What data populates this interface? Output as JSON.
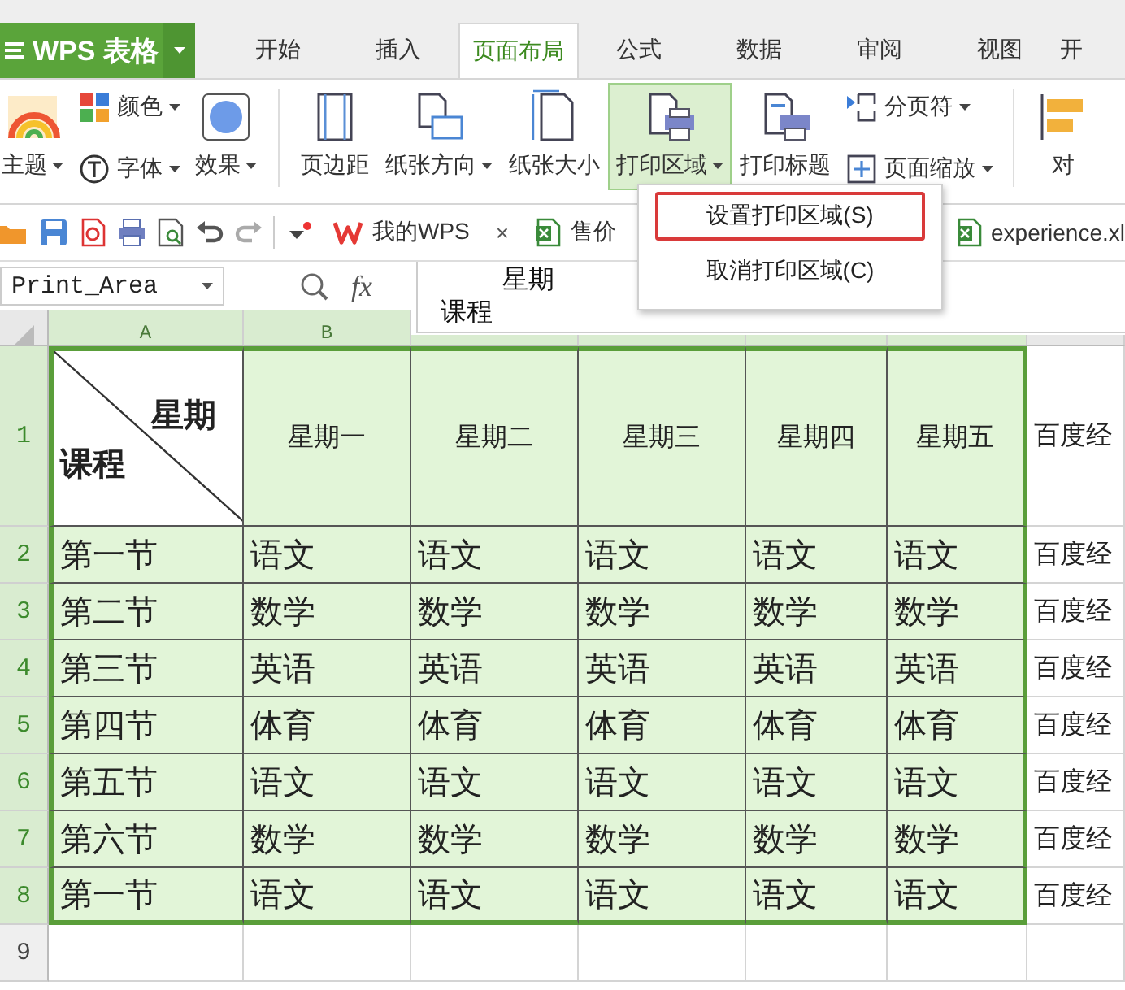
{
  "app_button": {
    "label": "WPS 表格"
  },
  "tabs": [
    {
      "label": "开始",
      "selected": false
    },
    {
      "label": "插入",
      "selected": false
    },
    {
      "label": "页面布局",
      "selected": true
    },
    {
      "label": "公式",
      "selected": false
    },
    {
      "label": "数据",
      "selected": false
    },
    {
      "label": "审阅",
      "selected": false
    },
    {
      "label": "视图",
      "selected": false
    },
    {
      "label": "开",
      "selected": false
    }
  ],
  "ribbon": [
    {
      "kind": "large",
      "label": "主题",
      "dropdown": true,
      "open": false
    },
    {
      "kind": "small",
      "label": "颜色",
      "dropdown": true,
      "open": false
    },
    {
      "kind": "small",
      "label": "字体",
      "dropdown": true,
      "open": false
    },
    {
      "kind": "large",
      "label": "效果",
      "dropdown": true,
      "open": false
    },
    {
      "kind": "separator"
    },
    {
      "kind": "large",
      "label": "页边距",
      "dropdown": false,
      "open": false
    },
    {
      "kind": "large",
      "label": "纸张方向",
      "dropdown": true,
      "open": false
    },
    {
      "kind": "large",
      "label": "纸张大小",
      "dropdown": false,
      "open": false
    },
    {
      "kind": "large",
      "label": "打印区域",
      "dropdown": true,
      "open": true
    },
    {
      "kind": "large",
      "label": "打印标题",
      "dropdown": false,
      "open": false
    },
    {
      "kind": "small",
      "label": "分页符",
      "dropdown": true,
      "open": false
    },
    {
      "kind": "small",
      "label": "页面缩放",
      "dropdown": true,
      "open": false
    },
    {
      "kind": "separator"
    },
    {
      "kind": "large",
      "label": "对",
      "dropdown": false,
      "open": false
    }
  ],
  "doc_tabs": [
    {
      "label": "我的WPS",
      "close_glyph": "×"
    },
    {
      "label": "售价"
    },
    {
      "label": "experience.xl"
    }
  ],
  "name_box": {
    "value": "Print_Area"
  },
  "formula": {
    "function_button": "fx",
    "lines": [
      "星期",
      "课程"
    ]
  },
  "menu": {
    "items": [
      {
        "label": "设置打印区域(S)",
        "selected": true
      },
      {
        "label": "取消打印区域(C)",
        "selected": false
      }
    ]
  },
  "sheet": {
    "columns": [
      {
        "label": "A",
        "in_print_area": true
      },
      {
        "label": "B",
        "in_print_area": true
      },
      {
        "in_print_area": true
      },
      {
        "in_print_area": true
      },
      {
        "in_print_area": true
      },
      {
        "in_print_area": true
      },
      {
        "in_print_area": false
      }
    ],
    "rows": [
      {
        "number": "1",
        "in_print_area": true,
        "cells": [
          {
            "kind": "diagonal",
            "top": "星期",
            "bottom": "课程"
          },
          {
            "kind": "centered",
            "text": "星期一"
          },
          {
            "kind": "centered",
            "text": "星期二"
          },
          {
            "kind": "centered",
            "text": "星期三"
          },
          {
            "kind": "centered",
            "text": "星期四"
          },
          {
            "kind": "centered",
            "text": "星期五"
          },
          {
            "kind": "plain",
            "text": "百度经"
          }
        ]
      },
      {
        "number": "2",
        "in_print_area": true,
        "cells": [
          "第一节",
          "语文",
          "语文",
          "语文",
          "语文",
          "语文",
          "百度经"
        ]
      },
      {
        "number": "3",
        "in_print_area": true,
        "cells": [
          "第二节",
          "数学",
          "数学",
          "数学",
          "数学",
          "数学",
          "百度经"
        ]
      },
      {
        "number": "4",
        "in_print_area": true,
        "cells": [
          "第三节",
          "英语",
          "英语",
          "英语",
          "英语",
          "英语",
          "百度经"
        ]
      },
      {
        "number": "5",
        "in_print_area": true,
        "cells": [
          "第四节",
          "体育",
          "体育",
          "体育",
          "体育",
          "体育",
          "百度经"
        ]
      },
      {
        "number": "6",
        "in_print_area": true,
        "cells": [
          "第五节",
          "语文",
          "语文",
          "语文",
          "语文",
          "语文",
          "百度经"
        ]
      },
      {
        "number": "7",
        "in_print_area": true,
        "cells": [
          "第六节",
          "数学",
          "数学",
          "数学",
          "数学",
          "数学",
          "百度经"
        ]
      },
      {
        "number": "8",
        "in_print_area": true,
        "cells": [
          "第一节",
          "语文",
          "语文",
          "语文",
          "语文",
          "语文",
          "百度经"
        ]
      },
      {
        "number": "9",
        "in_print_area": false
      }
    ]
  }
}
